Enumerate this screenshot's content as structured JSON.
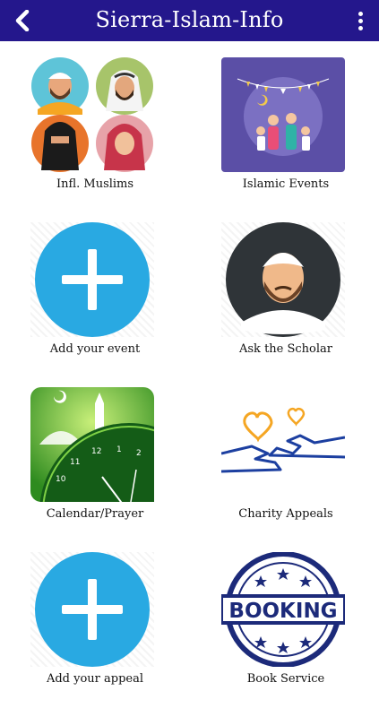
{
  "app": {
    "title": "Sierra-Islam-Info"
  },
  "colors": {
    "appbar": "#24178c",
    "plus_blue": "#29a9e2",
    "booking_navy": "#1c2a7a",
    "events_purple": "#5b4fa6"
  },
  "icons": {
    "back": "chevron-left-icon",
    "menu": "more-vertical-icon"
  },
  "tiles": [
    {
      "label": "Infl. Muslims"
    },
    {
      "label": "Islamic Events"
    },
    {
      "label": "Add your event"
    },
    {
      "label": "Ask the Scholar"
    },
    {
      "label": "Calendar/Prayer"
    },
    {
      "label": "Charity Appeals"
    },
    {
      "label": "Add your appeal"
    },
    {
      "label": "Book Service"
    }
  ],
  "booking_stamp": {
    "text": "BOOKING"
  }
}
